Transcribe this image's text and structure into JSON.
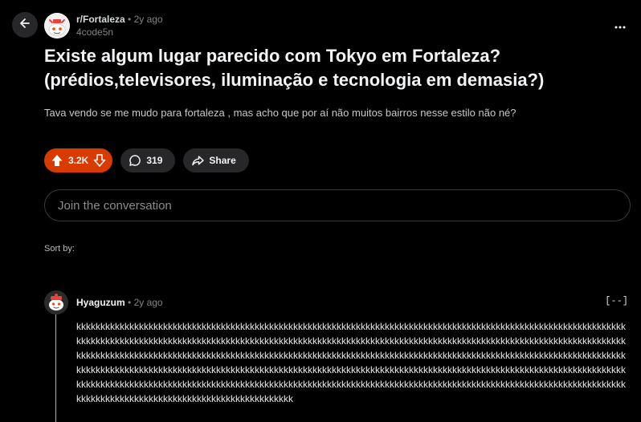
{
  "post": {
    "subreddit": "r/Fortaleza",
    "age": "2y ago",
    "author": "4code5n",
    "title": "Existe algum lugar parecido com Tokyo em Fortaleza? (prédios,televisores, iluminação e tecnologia em demasia?)",
    "body": "Tava vendo se me mudo para fortaleza , mas acho que por aí não muitos bairros nesse estilo não né?"
  },
  "actions": {
    "score": "3.2K",
    "comments": "319",
    "share_label": "Share"
  },
  "join": {
    "placeholder": "Join the conversation"
  },
  "sort": {
    "label": "Sort by:"
  },
  "comment": {
    "author": "Hyaguzum",
    "age": "2y ago",
    "collapse_label": "[--]",
    "body": "kkkkkkkkkkkkkkkkkkkkkkkkkkkkkkkkkkkkkkkkkkkkkkkkkkkkkkkkkkkkkkkkkkkkkkkkkkkkkkkkkkkkkkkkkkkkkkkkkkkkkkkkkkkkkkkkkkkkkkkkkkkkkkkkkkkkkkkkkkkkkkkkkkkkkkkkkkkkkkkkkkkkkkkkkkkkkkkkkkkkkkkkkkkkkkkkkkkkkkkkkkkkkkkkkkkkkkkkkkkkkkkkkkkkkkkkkkkkkkkkkkkkkkkkkkkkkkkkkkkkkkkkkkkkkkkkkkkkkkkkkkkkkkkkkkkkkkkkkkkkkkkkkkkkkkkkkkkkkkkkkkkkkkkkkkkkkkkkkkkkkkkkkkkkkkkkkkkkkkkkkkkkkkkkkkkkkkkkkkkkkkkkkkkkkkkkkkkkkkkkkkkkkkkkkkkkkkkkkkkkkkkkkkkkkkkkkkkkkkkkkkkkkkkkkkkkkkkkkkkkkkkkkkkkkkkkkkkkkkkkkkkkkkkkkkkkkkkkkkkkkkkkkkkkkkkkkkkkkkkkkkkkkkkkkkkkkkkkkkkkkkkkkkkkkkkkkkkkkkkkkkkkkkkkkkkkkkkkkkkkkkkkkkkkkkkkkkkkkkkkkkkkkkkkkkkkkkk"
  },
  "colors": {
    "background": "#000000",
    "upvote_accent": "#d93a00",
    "thread_line": "#57e389",
    "pill_bg": "#272729"
  },
  "icons": {
    "back": "arrow-left-icon",
    "more": "more-horizontal-icon",
    "upvote": "upvote-arrow-icon",
    "downvote": "downvote-arrow-icon",
    "comment": "speech-bubble-icon",
    "share": "share-arrow-icon"
  }
}
